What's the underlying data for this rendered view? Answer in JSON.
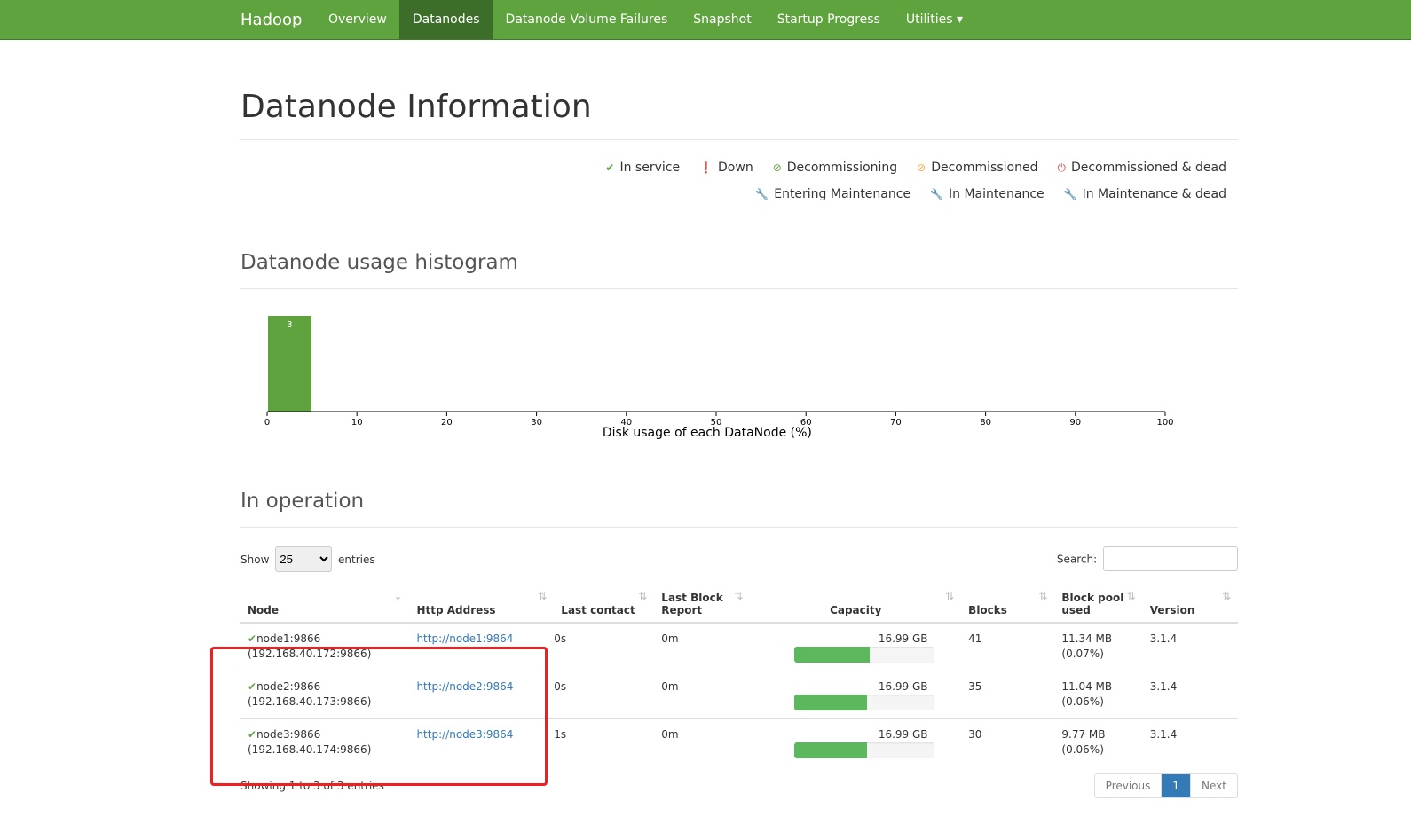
{
  "nav": {
    "brand": "Hadoop",
    "items": [
      "Overview",
      "Datanodes",
      "Datanode Volume Failures",
      "Snapshot",
      "Startup Progress",
      "Utilities ▾"
    ],
    "active": 1
  },
  "page_title": "Datanode Information",
  "legend": [
    {
      "label": "In service",
      "icon": "check-icon",
      "color": "#5fa33e"
    },
    {
      "label": "Down",
      "icon": "exclamation-circle-icon",
      "color": "#c9302c"
    },
    {
      "label": "Decommissioning",
      "icon": "ban-icon",
      "color": "#5fa33e"
    },
    {
      "label": "Decommissioned",
      "icon": "ban-icon",
      "color": "#f0ad4e"
    },
    {
      "label": "Decommissioned & dead",
      "icon": "power-icon",
      "color": "#d9534f"
    },
    {
      "label": "Entering Maintenance",
      "icon": "wrench-icon",
      "color": "#5fa33e"
    },
    {
      "label": "In Maintenance",
      "icon": "wrench-icon",
      "color": "#f0ad4e"
    },
    {
      "label": "In Maintenance & dead",
      "icon": "wrench-icon",
      "color": "#d9534f"
    }
  ],
  "histogram_title": "Datanode usage histogram",
  "chart_data": {
    "type": "bar",
    "xlabel": "Disk usage of each DataNode (%)",
    "xlim": [
      0,
      100
    ],
    "xticks": [
      0,
      10,
      20,
      30,
      40,
      50,
      60,
      70,
      80,
      90,
      100
    ],
    "bins": [
      {
        "x0": 0,
        "x1": 5,
        "count": 3
      }
    ],
    "color": "#5fa33e"
  },
  "in_operation_title": "In operation",
  "controls": {
    "show": "Show",
    "entries": "entries",
    "page_size": "25",
    "search": "Search:",
    "search_value": ""
  },
  "table": {
    "headers": [
      "Node",
      "Http Address",
      "Last contact",
      "Last Block Report",
      "Capacity",
      "Blocks",
      "Block pool used",
      "Version"
    ],
    "rows": [
      {
        "node": "node1:9866",
        "ip": "(192.168.40.172:9866)",
        "http": "http://node1:9864",
        "last_contact": "0s",
        "last_block": "0m",
        "capacity": "16.99 GB",
        "used_pct": 54,
        "blocks": "41",
        "bp_used": "11.34 MB",
        "bp_pct": "(0.07%)",
        "version": "3.1.4"
      },
      {
        "node": "node2:9866",
        "ip": "(192.168.40.173:9866)",
        "http": "http://node2:9864",
        "last_contact": "0s",
        "last_block": "0m",
        "capacity": "16.99 GB",
        "used_pct": 52,
        "blocks": "35",
        "bp_used": "11.04 MB",
        "bp_pct": "(0.06%)",
        "version": "3.1.4"
      },
      {
        "node": "node3:9866",
        "ip": "(192.168.40.174:9866)",
        "http": "http://node3:9864",
        "last_contact": "1s",
        "last_block": "0m",
        "capacity": "16.99 GB",
        "used_pct": 52,
        "blocks": "30",
        "bp_used": "9.77 MB",
        "bp_pct": "(0.06%)",
        "version": "3.1.4"
      }
    ]
  },
  "footer": {
    "info": "Showing 1 to 3 of 3 entries",
    "previous": "Previous",
    "page": "1",
    "next": "Next"
  }
}
